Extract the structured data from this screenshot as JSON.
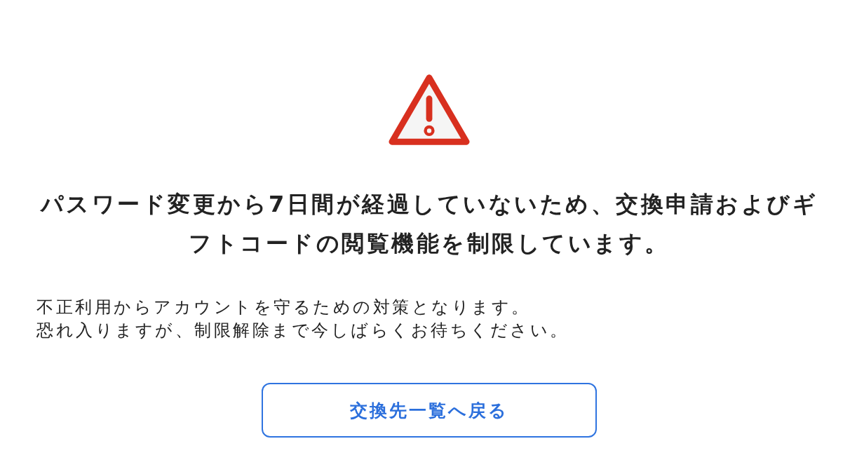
{
  "heading": "パスワード変更から7日間が経過していないため、交換申請およびギフトコードの閲覧機能を制限しています。",
  "message_lines": [
    "不正利用からアカウントを守るための対策となります。",
    "恐れ入りますが、制限解除まで今しばらくお待ちください。"
  ],
  "button": {
    "label": "交換先一覧へ戻る"
  }
}
